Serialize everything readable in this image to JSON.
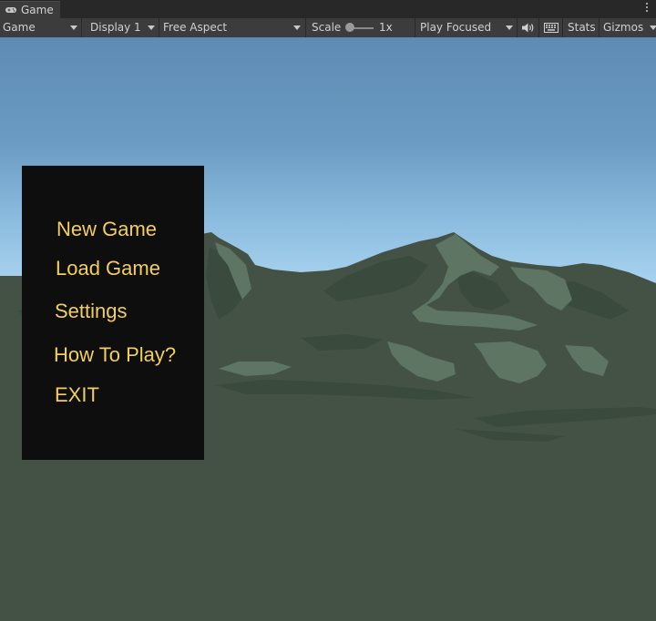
{
  "window": {
    "tab_title": "Game"
  },
  "toolbar": {
    "view_select": "Game",
    "display_select": "Display 1",
    "aspect_select": "Free Aspect",
    "scale_label": "Scale",
    "scale_value": "1x",
    "scale_level": 0,
    "play_mode_select": "Play Focused",
    "stats_label": "Stats",
    "gizmos_label": "Gizmos"
  },
  "icons": {
    "tab": "gamepad-icon",
    "mute": "speaker-icon",
    "keyboard": "keyboard-icon",
    "more": "kebab-menu-icon"
  },
  "main_menu": {
    "items": [
      "New Game",
      "Load Game",
      "Settings",
      "How To Play?",
      "EXIT"
    ],
    "text_color": "#f2cf5b",
    "panel_color": "#0e0e0e"
  },
  "scene": {
    "sky_top": "#5d8ab2",
    "sky_horizon": "#a9d3ef",
    "ground": "#435245"
  }
}
